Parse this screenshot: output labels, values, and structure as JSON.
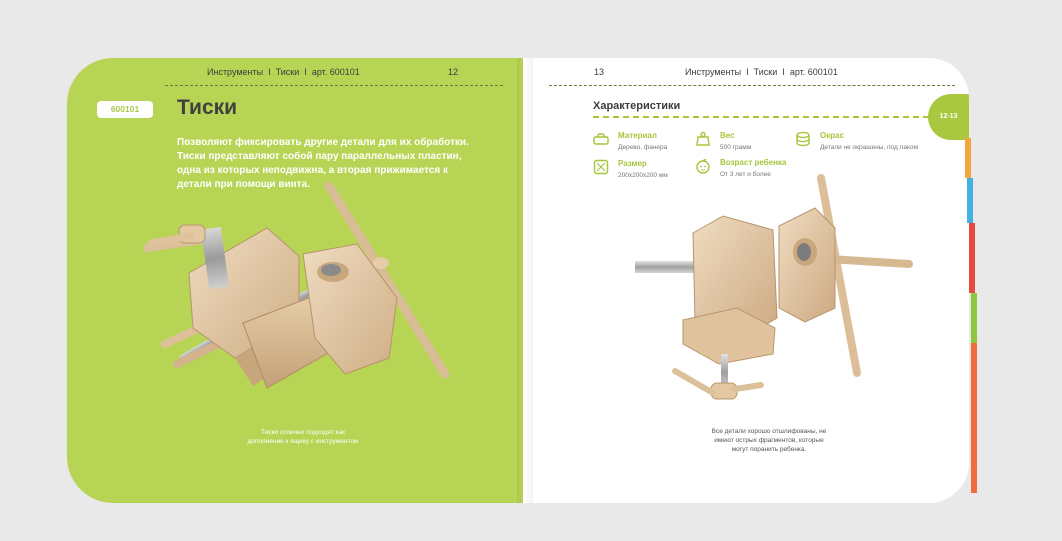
{
  "left_page": {
    "header": {
      "category": "Инструменты",
      "product": "Тиски",
      "article": "арт. 600101",
      "separator": "I",
      "page_number": "12"
    },
    "article_badge": "600101",
    "title": "Тиски",
    "description": "Позволяют фиксировать другие детали для их обработки. Тиски представляют собой пару параллельных пластин, одна из которых неподвижна, а вторая прижимается к детали при помощи винта.",
    "caption": "Тиски отлично подходят как дополнение к ящику с инструментом"
  },
  "right_page": {
    "header": {
      "page_number": "13",
      "category": "Инструменты",
      "product": "Тиски",
      "article": "арт. 600101",
      "separator": "I"
    },
    "section_title": "Характеристики",
    "page_tab": "12-13",
    "specs": {
      "material": {
        "label": "Материал",
        "value": "Дерево, фанера",
        "icon": "material-icon"
      },
      "weight": {
        "label": "Вес",
        "value": "500 грамм",
        "icon": "weight-icon"
      },
      "paint": {
        "label": "Окрас",
        "value": "Детали не окрашены, под лаком",
        "icon": "paint-icon"
      },
      "size": {
        "label": "Размер",
        "value": "200х200х200 мм",
        "icon": "size-icon"
      },
      "age": {
        "label": "Возраст ребенка",
        "value": "От 3 лет и более",
        "icon": "child-icon"
      }
    },
    "caption": "Все детали хорошо отшлифованы, не имеют острых фрагментов, которые могут поранить ребенка."
  },
  "colors": {
    "background": "#e9e9e9",
    "left_page": "#b7d455",
    "accent_green": "#a6c53b",
    "wood": "#e2c8a4",
    "tab_edges": [
      "#a9c83f",
      "#f2a640",
      "#43b2e0",
      "#e8483e",
      "#8dc63f",
      "#f16c3c"
    ]
  }
}
